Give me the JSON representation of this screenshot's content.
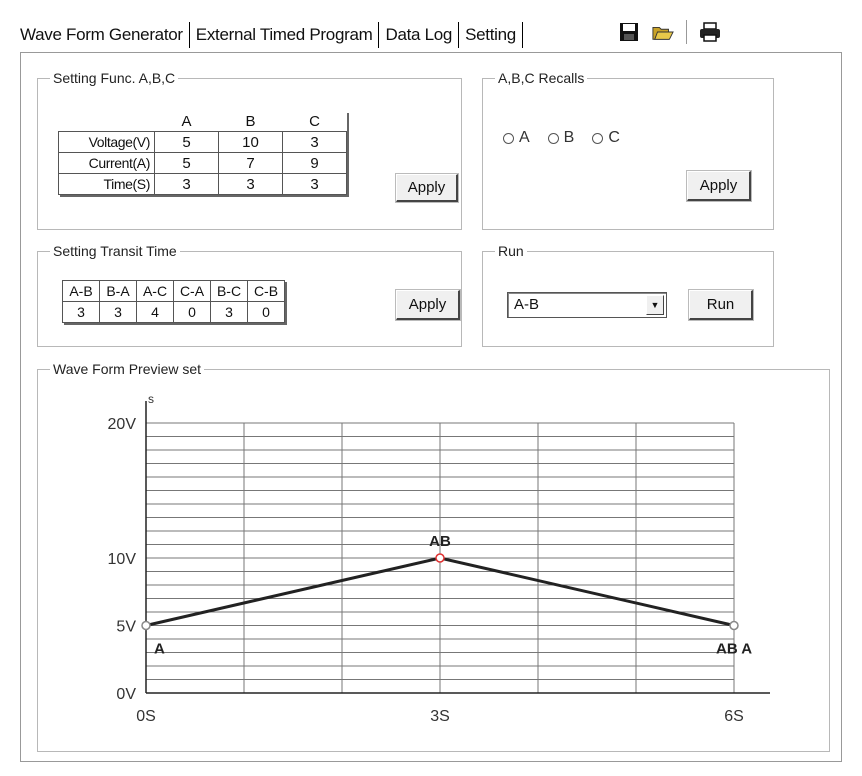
{
  "tabs": [
    {
      "label": "Wave Form Generator"
    },
    {
      "label": "External Timed Program"
    },
    {
      "label": "Data Log"
    },
    {
      "label": "Setting"
    }
  ],
  "toolbar": {
    "save_icon": "floppy-disk-icon",
    "open_icon": "open-folder-icon",
    "print_icon": "printer-icon"
  },
  "func": {
    "title": "Setting Func. A,B,C",
    "columns": [
      "A",
      "B",
      "C"
    ],
    "rows": [
      {
        "label": "Voltage(V)",
        "values": [
          "5",
          "10",
          "3"
        ]
      },
      {
        "label": "Current(A)",
        "values": [
          "5",
          "7",
          "9"
        ]
      },
      {
        "label": "Time(S)",
        "values": [
          "3",
          "3",
          "3"
        ]
      }
    ],
    "apply_label": "Apply"
  },
  "recalls": {
    "title": "A,B,C Recalls",
    "options": [
      "A",
      "B",
      "C"
    ],
    "apply_label": "Apply"
  },
  "transit": {
    "title": "Setting Transit Time",
    "columns": [
      "A-B",
      "B-A",
      "A-C",
      "C-A",
      "B-C",
      "C-B"
    ],
    "values": [
      "3",
      "3",
      "4",
      "0",
      "3",
      "0"
    ],
    "apply_label": "Apply"
  },
  "run": {
    "title": "Run",
    "selected": "A-B",
    "button_label": "Run"
  },
  "preview": {
    "title": "Wave Form Preview set"
  },
  "chart_data": {
    "type": "line",
    "ylim": [
      0,
      20
    ],
    "xlim": [
      0,
      6
    ],
    "y_ticks": [
      {
        "v": 0,
        "label": "0V"
      },
      {
        "v": 5,
        "label": "5V"
      },
      {
        "v": 10,
        "label": "10V"
      },
      {
        "v": 20,
        "label": "20V"
      }
    ],
    "x_ticks": [
      {
        "v": 0,
        "label": "0S"
      },
      {
        "v": 3,
        "label": "3S"
      },
      {
        "v": 6,
        "label": "6S"
      }
    ],
    "y_axis_label": "s",
    "points": [
      {
        "x": 0,
        "y": 5,
        "label": "A",
        "color": "#888888"
      },
      {
        "x": 3,
        "y": 10,
        "label": "AB",
        "color": "#e03030"
      },
      {
        "x": 6,
        "y": 5,
        "label": "AB A",
        "color": "#888888"
      }
    ],
    "line_color": "#222222",
    "grid": true
  }
}
